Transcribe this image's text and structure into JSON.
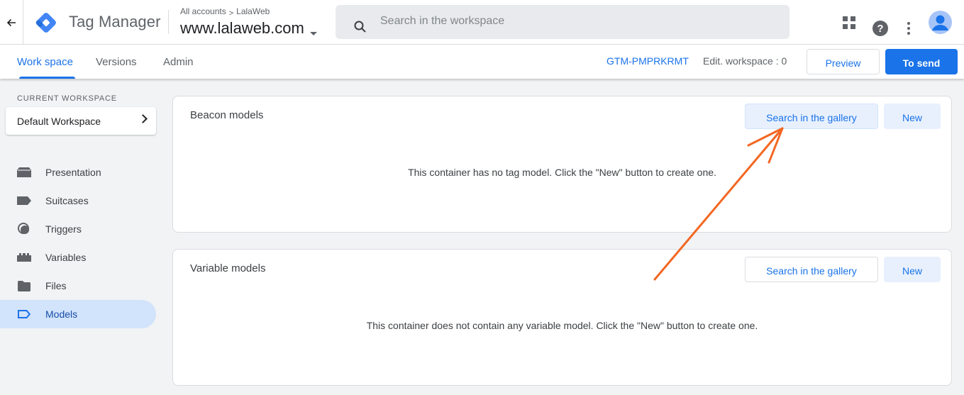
{
  "header": {
    "product_name": "Tag Manager",
    "breadcrumb": {
      "account_link": "All accounts",
      "separator": ">",
      "account_name": "LalaWeb"
    },
    "container_name": "www.lalaweb.com",
    "search": {
      "placeholder": "Search in the workspace",
      "value": ""
    },
    "icons": {
      "back": "arrow-left-icon",
      "apps": "apps-grid-icon",
      "help": "help-icon",
      "more": "more-vert-icon",
      "account": "account-avatar-icon"
    },
    "help_glyph": "?"
  },
  "subbar": {
    "tabs": [
      {
        "label": "Work space",
        "active": true
      },
      {
        "label": "Versions",
        "active": false
      },
      {
        "label": "Admin",
        "active": false
      }
    ],
    "container_id": "GTM-PMPRKRMT",
    "workspace_changes": "Edit. workspace : 0",
    "preview_label": "Preview",
    "submit_label": "To send"
  },
  "sidebar": {
    "current_workspace_label": "CURRENT WORKSPACE",
    "workspace_name": "Default Workspace",
    "items": [
      {
        "label": "Presentation",
        "icon": "overview-icon",
        "active": false
      },
      {
        "label": "Suitcases",
        "icon": "tag-icon",
        "active": false
      },
      {
        "label": "Triggers",
        "icon": "trigger-icon",
        "active": false
      },
      {
        "label": "Variables",
        "icon": "variables-icon",
        "active": false
      },
      {
        "label": "Files",
        "icon": "folder-icon",
        "active": false
      },
      {
        "label": "Models",
        "icon": "template-icon",
        "active": true
      }
    ]
  },
  "main": {
    "tag_templates": {
      "title": "Beacon models",
      "gallery_label": "Search in the gallery",
      "new_label": "New",
      "empty_message": "This container has no tag model. Click the \"New\" button to create one."
    },
    "variable_templates": {
      "title": "Variable models",
      "gallery_label": "Search in the gallery",
      "new_label": "New",
      "empty_message": "This container does not contain any variable model. Click the \"New\" button to create one."
    }
  },
  "annotation": {
    "type": "arrow",
    "color": "#f26722",
    "points_to": "tag-templates-gallery-button"
  },
  "colors": {
    "accent": "#1a73e8",
    "active_nav_bg": "#d2e3fc",
    "page_bg": "#f1f3f4"
  }
}
